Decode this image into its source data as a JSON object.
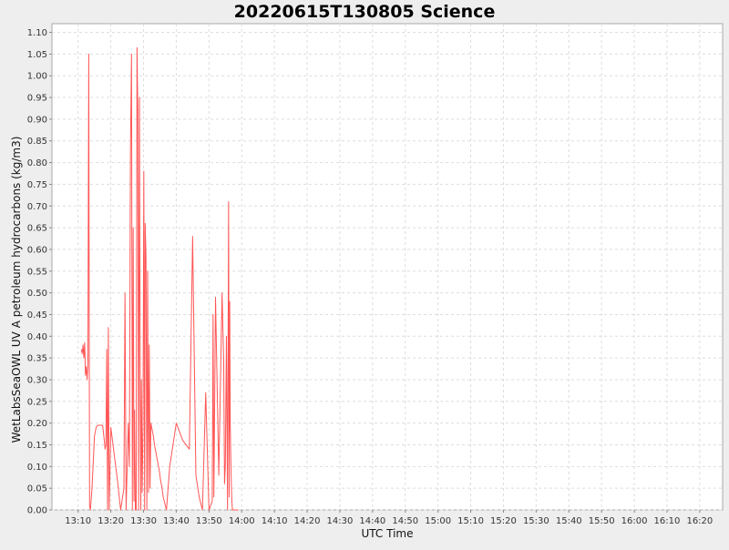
{
  "chart_data": {
    "type": "line",
    "title": "20220615T130805 Science",
    "xlabel": "UTC Time",
    "ylabel": "WetLabsSeaOWL UV A petroleum hydrocarbons (kg/m3)",
    "x_unit": "HH:MM UTC",
    "xlim": [
      "13:02",
      "16:27"
    ],
    "ylim": [
      0,
      1.12
    ],
    "x_ticks": [
      "13:10",
      "13:20",
      "13:30",
      "13:40",
      "13:50",
      "14:00",
      "14:10",
      "14:20",
      "14:30",
      "14:40",
      "14:50",
      "15:00",
      "15:10",
      "15:20",
      "15:30",
      "15:40",
      "15:50",
      "16:00",
      "16:10",
      "16:20"
    ],
    "y_ticks": [
      "0.00",
      "0.05",
      "0.10",
      "0.15",
      "0.20",
      "0.25",
      "0.30",
      "0.35",
      "0.40",
      "0.45",
      "0.50",
      "0.55",
      "0.60",
      "0.65",
      "0.70",
      "0.75",
      "0.80",
      "0.85",
      "0.90",
      "0.95",
      "1.00",
      "1.05",
      "1.10"
    ],
    "grid": true,
    "legend": "none",
    "background": "#eeeeee",
    "plot_background": "#ffffff",
    "grid_color": "#dddddd",
    "series_color": "#ff5555",
    "series": [
      {
        "x": [
          "13:11:00",
          "13:11:15",
          "13:11:30",
          "13:11:45",
          "13:12:00",
          "13:12:15",
          "13:12:30",
          "13:12:45",
          "13:13:00",
          "13:13:15",
          "13:13:30",
          "13:13:45",
          "13:14:15",
          "13:15:00",
          "13:15:30",
          "13:16:00",
          "13:16:30",
          "13:17:00",
          "13:17:30",
          "13:18:00",
          "13:18:15",
          "13:18:30",
          "13:18:45",
          "13:19:00",
          "13:19:15",
          "13:19:30",
          "13:20:00",
          "13:20:30",
          "13:21:00",
          "13:22:00",
          "13:23:00",
          "13:24:00",
          "13:24:20",
          "13:24:40",
          "13:25:00",
          "13:25:20",
          "13:25:40",
          "13:26:00",
          "13:26:20",
          "13:26:35",
          "13:26:50",
          "13:27:05",
          "13:27:15",
          "13:27:30",
          "13:27:45",
          "13:28:00",
          "13:28:15",
          "13:28:30",
          "13:28:45",
          "13:29:00",
          "13:29:10",
          "13:29:20",
          "13:29:35",
          "13:29:50",
          "13:30:05",
          "13:30:20",
          "13:30:30",
          "13:30:45",
          "13:31:00",
          "13:31:15",
          "13:31:30",
          "13:31:45",
          "13:32:00",
          "13:32:15",
          "13:32:30",
          "13:32:45",
          "13:33:00",
          "13:33:10",
          "13:33:20",
          "13:33:35",
          "13:33:50",
          "13:34:05",
          "13:34:20",
          "13:34:35",
          "13:34:50",
          "13:35:00",
          "13:35:10",
          "13:35:25",
          "13:35:40",
          "13:36:00",
          "13:37:00",
          "13:38:00",
          "13:39:00",
          "13:40:00",
          "13:41:00",
          "13:42:00",
          "13:43:00",
          "13:44:00",
          "13:45:00",
          "13:46:00",
          "13:47:00",
          "13:48:00",
          "13:49:00",
          "13:50:00",
          "13:51:00",
          "13:51:15",
          "13:51:30",
          "13:52:00",
          "13:53:00",
          "13:54:00",
          "13:54:30",
          "13:54:45",
          "13:55:00",
          "13:55:20",
          "13:55:40",
          "13:56:00",
          "13:56:10",
          "13:56:20",
          "13:56:30",
          "13:56:40",
          "13:56:50",
          "13:57:00",
          "13:57:10",
          "13:57:20",
          "13:57:30",
          "13:57:40",
          "13:57:50",
          "13:58:00",
          "13:58:10",
          "13:58:20",
          "13:58:30",
          "13:58:40",
          "13:58:50",
          "13:59:00"
        ],
        "y": [
          0.37,
          0.36,
          0.38,
          0.35,
          0.385,
          0.31,
          0.33,
          0.3,
          0.335,
          1.05,
          0.01,
          0.0,
          0.05,
          0.17,
          0.19,
          0.195,
          0.195,
          0.195,
          0.195,
          0.16,
          0.14,
          0.15,
          0.37,
          0.0,
          0.42,
          0.0,
          0.19,
          0.16,
          0.13,
          0.07,
          0.0,
          0.05,
          0.5,
          0.0,
          0.1,
          0.2,
          0.1,
          0.83,
          1.05,
          0.0,
          0.65,
          0.02,
          0.23,
          0.0,
          0.0,
          1.065,
          0.92,
          0.0,
          0.95,
          0.25,
          0.0,
          0.3,
          0.04,
          0.2,
          0.78,
          0.0,
          0.66,
          0.58,
          0.0,
          0.55,
          0.04,
          0.38,
          0.05,
          0.2,
          0.19,
          0.18,
          0.17,
          0.16,
          0.15,
          0.14,
          0.13,
          0.12,
          0.11,
          0.1,
          0.09,
          0.08,
          0.07,
          0.06,
          0.05,
          0.03,
          0.0,
          0.1,
          0.15,
          0.2,
          0.18,
          0.16,
          0.15,
          0.14,
          0.63,
          0.08,
          0.03,
          0.0,
          0.27,
          0.0,
          0.02,
          0.45,
          0.03,
          0.49,
          0.08,
          0.5,
          0.34,
          0.06,
          0.1,
          0.4,
          0.0,
          0.71,
          0.03,
          0.48,
          0.2,
          0.12,
          0.06,
          0.02,
          0.0,
          0.0,
          0.0,
          0.0,
          0.0,
          0.0,
          0.0,
          0.0,
          0.0,
          0.0,
          0.0,
          0.0
        ]
      }
    ]
  }
}
